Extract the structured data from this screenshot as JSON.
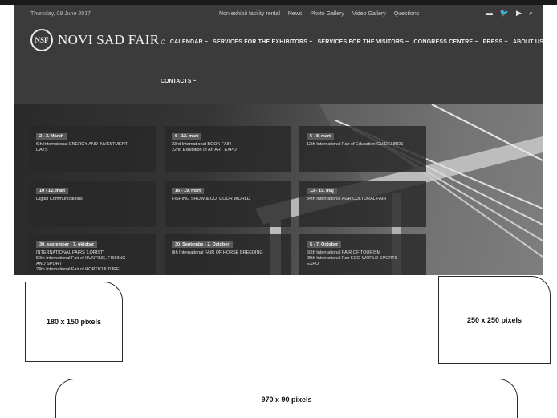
{
  "header": {
    "date": "Thursday, 08 June 2017",
    "top_links": [
      "Non exhibit facility rental",
      "News",
      "Photo Gallery",
      "Video Gallery",
      "Questions"
    ],
    "icons": [
      "language-flag-icon",
      "twitter-icon",
      "youtube-icon",
      "search-icon"
    ],
    "logo_emblem": "NSF",
    "logo_text": "NOVI SAD FAIR",
    "nav": [
      "CALENDAR ~",
      "SERVICES FOR THE EXHIBITORS ~",
      "SERVICES FOR THE VISITORS ~",
      "CONGRESS CENTRE ~",
      "PRESS ~",
      "ABOUT US ~"
    ],
    "nav_row2": "CONTACTS ~"
  },
  "events": [
    {
      "date": "2 - 3. March",
      "lines": [
        "6th International ENERGY AND INVESTMENT",
        "DAYS"
      ]
    },
    {
      "date": "6 - 12. mart",
      "lines": [
        "23rd International BOOK FAIR",
        "22nd Exhibition of Art ART EXPO"
      ]
    },
    {
      "date": "6 - 8. mart",
      "lines": [
        "12th International Fair of Education GUIDELINES"
      ]
    },
    {
      "date": "10 - 12. mart",
      "lines": [
        "Digital Communications"
      ]
    },
    {
      "date": "16 - 19. mart",
      "lines": [
        "FISHING SHOW & OUTDOOR WORLD"
      ]
    },
    {
      "date": "13 - 19. maj",
      "lines": [
        "84th International AGRICULTURAL FAIR"
      ]
    },
    {
      "date": "30. septembar - 7. oktobar",
      "lines": [
        "INTERNATIONAL FAIRS 'LORIST'",
        "50th International Fair of HUNTING, FISHING",
        "AND SPORT",
        "24th International Fair of HORTICULTURE"
      ]
    },
    {
      "date": "30. Septembe - 2. October",
      "lines": [
        "8th International FAIR OF HORSE BREEDING"
      ]
    },
    {
      "date": "5 - 7. October",
      "lines": [
        "50th International FAIR OF TOURISM",
        "25th International Fair ECO-WORLD SPORTS",
        "EXPO"
      ]
    }
  ],
  "ads": {
    "small": "180 x 150 pixels",
    "square": "250 x 250 pixels",
    "leaderboard": "970 x 90 pixels"
  }
}
